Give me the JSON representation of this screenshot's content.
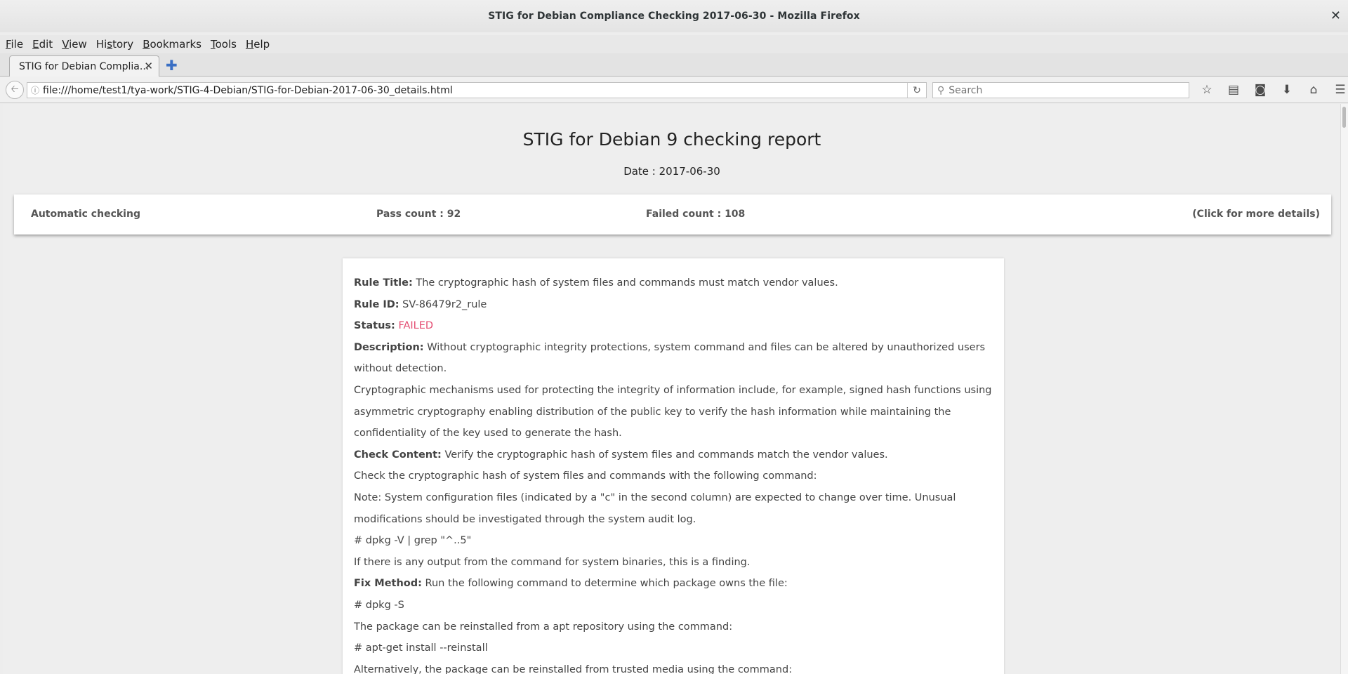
{
  "window": {
    "title": "STIG for Debian Compliance Checking 2017-06-30 - Mozilla Firefox"
  },
  "menu": [
    {
      "pre": "",
      "u": "F",
      "post": "ile"
    },
    {
      "pre": "",
      "u": "E",
      "post": "dit"
    },
    {
      "pre": "",
      "u": "V",
      "post": "iew"
    },
    {
      "pre": "Hi",
      "u": "s",
      "post": "tory"
    },
    {
      "pre": "",
      "u": "B",
      "post": "ookmarks"
    },
    {
      "pre": "",
      "u": "T",
      "post": "ools"
    },
    {
      "pre": "",
      "u": "H",
      "post": "elp"
    }
  ],
  "tab": {
    "label": "STIG for Debian Complia..."
  },
  "nav": {
    "url": "file:///home/test1/tya-work/STIG-4-Debian/STIG-for-Debian-2017-06-30_details.html",
    "search_placeholder": "Search"
  },
  "page": {
    "title": "STIG for Debian 9 checking report",
    "date": "Date :  2017-06-30"
  },
  "summary": {
    "mode": "Automatic checking",
    "pass": "Pass count : 92",
    "failed": "Failed count : 108",
    "more": "(Click for more details)"
  },
  "rule": {
    "title_label": "Rule Title:",
    "title": " The cryptographic hash of system files and commands must match vendor values.",
    "id_label": "Rule ID:",
    "id": " SV-86479r2_rule",
    "status_label": "Status:",
    "status": " FAILED",
    "desc_label": "Description:",
    "desc": " Without cryptographic integrity protections, system command and files can be altered by unauthorized users without detection.",
    "desc2": "Cryptographic mechanisms used for protecting the integrity of information include, for example, signed hash functions using asymmetric cryptography enabling distribution of the public key to verify the hash information while maintaining the confidentiality of the key used to generate the hash.",
    "check_label": "Check Content:",
    "check": " Verify the cryptographic hash of system files and commands match the vendor values.",
    "check2": "Check the cryptographic hash of system files and commands with the following command:",
    "check3": "Note: System configuration files (indicated by a \"c\" in the second column) are expected to change over time. Unusual modifications should be investigated through the system audit log.",
    "check4": "# dpkg -V | grep \"^..5\"",
    "check5": "If there is any output from the command for system binaries, this is a finding.",
    "fix_label": "Fix Method:",
    "fix": " Run the following command to determine which package owns the file:",
    "fix2": "# dpkg -S",
    "fix3": "The package can be reinstalled from a apt repository using the command:",
    "fix4": "# apt-get install --reinstall",
    "fix5": "Alternatively, the package can be reinstalled from trusted media using the command:"
  },
  "colors": {
    "failed": "#e44d72"
  },
  "icons": [
    "back-arrow-icon",
    "info-icon",
    "reload-icon",
    "search-icon",
    "bookmark-star-icon",
    "reading-list-icon",
    "pocket-icon",
    "download-icon",
    "home-icon",
    "menu-hamburger-icon",
    "close-icon",
    "new-tab-plus-icon"
  ]
}
